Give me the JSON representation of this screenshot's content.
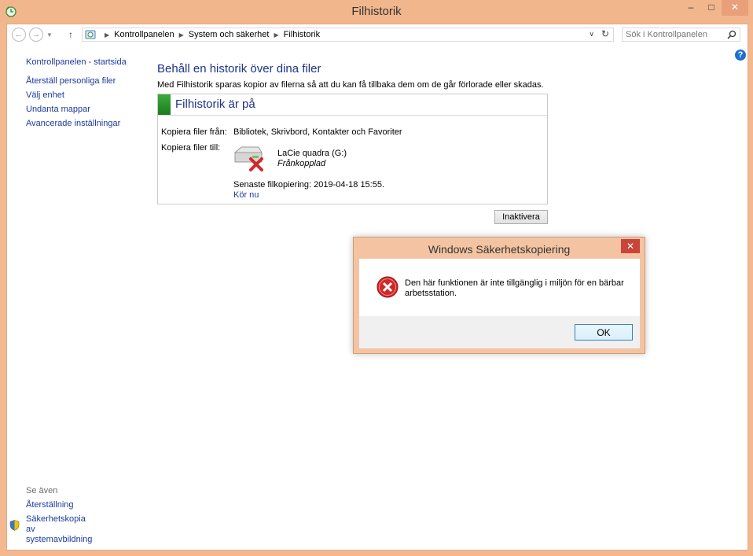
{
  "window": {
    "title": "Filhistorik",
    "minimize_glyph": "–",
    "maximize_glyph": "□",
    "close_glyph": "✕"
  },
  "address_bar": {
    "breadcrumbs": [
      "Kontrollpanelen",
      "System och säkerhet",
      "Filhistorik"
    ],
    "search_placeholder": "Sök i Kontrollpanelen"
  },
  "sidebar": {
    "home": "Kontrollpanelen - startsida",
    "items": [
      "Återställ personliga filer",
      "Välj enhet",
      "Undanta mappar",
      "Avancerade inställningar"
    ]
  },
  "see_also": {
    "title": "Se även",
    "items": [
      "Återställning",
      "Säkerhetskopia av systemavbildning"
    ]
  },
  "main": {
    "title": "Behåll en historik över dina filer",
    "description": "Med Filhistorik sparas kopior av filerna så att du kan få tillbaka dem om de går förlorade eller skadas.",
    "status": "Filhistorik är på",
    "copy_from_label": "Kopiera filer från:",
    "copy_from_value": "Bibliotek, Skrivbord, Kontakter och Favoriter",
    "copy_to_label": "Kopiera filer till:",
    "drive_name": "LaCie quadra (G:)",
    "drive_status": "Frånkopplad",
    "last_copy": "Senaste filkopiering: 2019-04-18 15:55.",
    "run_now": "Kör nu",
    "deactivate_label": "Inaktivera"
  },
  "dialog": {
    "title": "Windows Säkerhetskopiering",
    "message": "Den här funktionen är inte tillgänglig i miljön för en bärbar arbetsstation.",
    "ok_label": "OK"
  },
  "colors": {
    "accent": "#1e3287",
    "link": "#1b3b9a",
    "status_green": "#2b8f2b",
    "error_red": "#d02828"
  },
  "icons": [
    "app-icon",
    "back-icon",
    "forward-icon",
    "up-arrow-icon",
    "control-panel-icon",
    "refresh-icon",
    "search-icon",
    "help-icon",
    "drive-icon",
    "disconnected-x-icon",
    "shield-icon",
    "error-icon",
    "close-icon"
  ]
}
